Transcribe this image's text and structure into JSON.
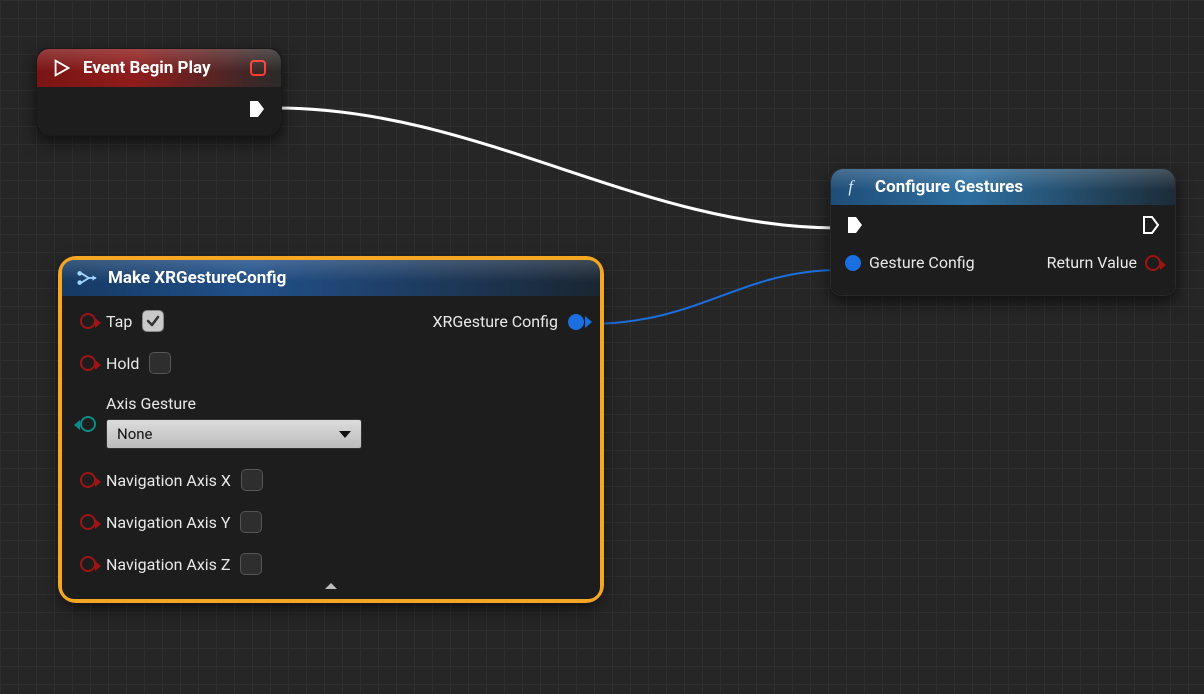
{
  "event_node": {
    "title": "Event Begin Play"
  },
  "configure_node": {
    "title": "Configure Gestures",
    "input_pin_label": "Gesture Config",
    "output_pin_label": "Return Value"
  },
  "make_node": {
    "title": "Make XRGestureConfig",
    "output_pin_label": "XRGesture Config",
    "inputs": {
      "tap": {
        "label": "Tap",
        "checked": true
      },
      "hold": {
        "label": "Hold",
        "checked": false
      },
      "axis_gesture": {
        "label": "Axis Gesture",
        "value": "None"
      },
      "nav_x": {
        "label": "Navigation Axis X",
        "checked": false
      },
      "nav_y": {
        "label": "Navigation Axis Y",
        "checked": false
      },
      "nav_z": {
        "label": "Navigation Axis Z",
        "checked": false
      }
    }
  }
}
